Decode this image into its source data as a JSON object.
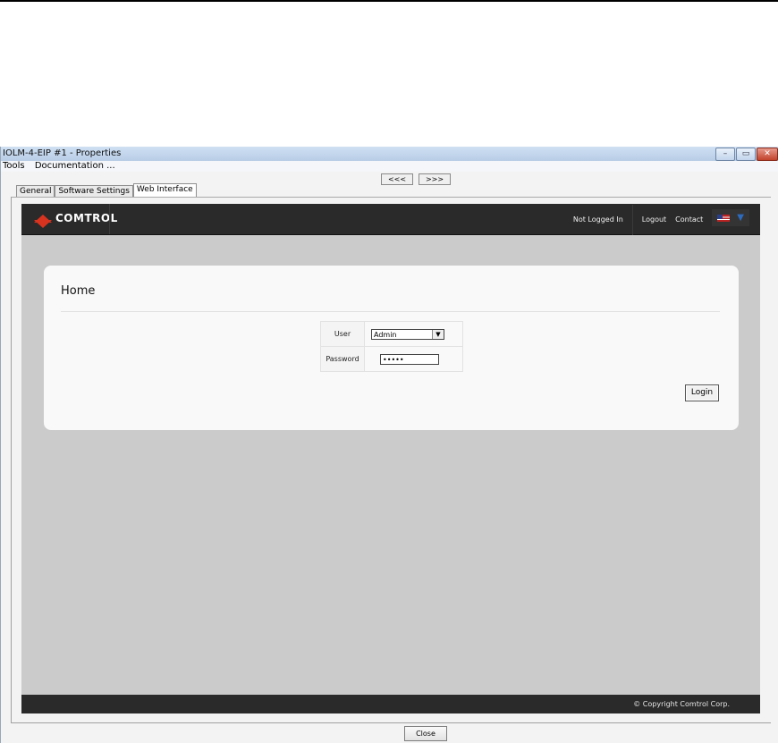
{
  "window": {
    "title": "IOLM-4-EIP #1 - Properties",
    "controls": [
      "–",
      "▭",
      "✕"
    ]
  },
  "menubar": {
    "items": [
      "Tools",
      "Documentation ..."
    ]
  },
  "nav": {
    "back_label": "<<<",
    "forward_label": ">>>"
  },
  "tabs": [
    "General",
    "Software Settings",
    "Web Interface"
  ],
  "web": {
    "logo_text": "Comtrol",
    "header": {
      "status": "Not Logged In",
      "logout": "Logout",
      "contact": "Contact",
      "filter_icon": "funnel-icon",
      "flag_icon": "us-flag-icon"
    },
    "card": {
      "title": "Home",
      "user_label": "User",
      "user_value": "Admin",
      "password_label": "Password",
      "password_value": "•••••",
      "login_label": "Login"
    },
    "footer": {
      "copyright": "© Copyright Comtrol Corp."
    }
  },
  "dialog": {
    "close_label": "Close"
  },
  "colors": {
    "header_bg": "#2a2a2a",
    "logo_red": "#d8331f",
    "content_bg": "#cbcbcb",
    "card_bg": "#f9f9f9"
  }
}
